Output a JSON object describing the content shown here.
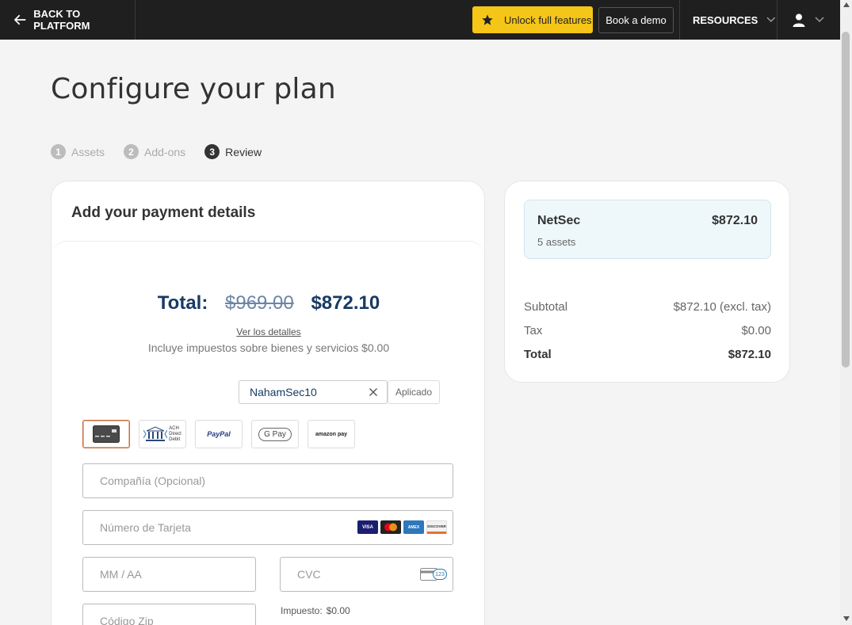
{
  "topbar": {
    "back_label": "BACK TO PLATFORM",
    "unlock_label": "Unlock full features",
    "demo_label": "Book a demo",
    "resources_label": "RESOURCES",
    "accent": "#f5c518"
  },
  "page": {
    "title": "Configure your plan"
  },
  "steps": [
    {
      "num": "1",
      "label": "Assets"
    },
    {
      "num": "2",
      "label": "Add-ons"
    },
    {
      "num": "3",
      "label": "Review"
    }
  ],
  "payment": {
    "title": "Add your payment details",
    "total_label": "Total:",
    "old_price": "$969.00",
    "new_price": "$872.10",
    "details_link": "Ver los detalles",
    "tax_note": "Incluye impuestos sobre bienes y servicios $0.00",
    "coupon_value": "NahamSec10",
    "coupon_status": "Aplicado",
    "methods": {
      "ach_text_1": "ACH",
      "ach_text_2": "Direct",
      "ach_text_3": "Debit",
      "paypal": "PayPal",
      "gpay": "G Pay",
      "amazon": "amazon pay"
    },
    "company_placeholder": "Compañía (Opcional)",
    "card_placeholder": "Número de Tarjeta",
    "card_brands": [
      "VISA",
      "MC",
      "AMEX",
      "DISCOVER"
    ],
    "expiry_placeholder": "MM / AA",
    "cvc_placeholder": "CVC",
    "cvc_badge": "123",
    "zip_placeholder": "Código Zip",
    "impuesto_label": "Impuesto:",
    "impuesto_value": "$0.00"
  },
  "summary": {
    "product_name": "NetSec",
    "product_price": "$872.10",
    "product_assets": "5 assets",
    "subtotal_label": "Subtotal",
    "subtotal_value": "$872.10 (excl. tax)",
    "tax_label": "Tax",
    "tax_value": "$0.00",
    "total_label": "Total",
    "total_value": "$872.10"
  }
}
